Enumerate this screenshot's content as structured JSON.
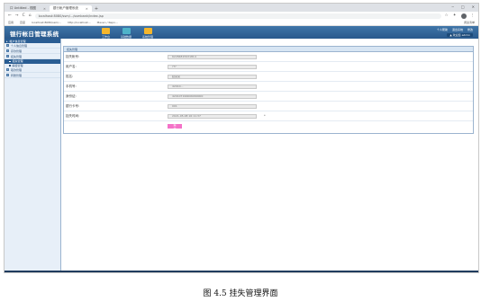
{
  "browser": {
    "tabs": [
      {
        "label": "口 Untitled - 视图",
        "active": false
      },
      {
        "label": "银行帐户管理系统",
        "active": true
      }
    ],
    "new_tab": "+",
    "window_controls": [
      "─",
      "□",
      "✕"
    ],
    "nav_buttons": [
      "←",
      "→",
      "C",
      "⌂"
    ],
    "url": "localhost:8080/ssm/.../ssmbank/index.jsp",
    "bookmarks": [
      "应用",
      "百度",
      "localhost:8080/ssm/...",
      "http://localhost...",
      "Maven / Repo..."
    ],
    "bookmarks_right": "阅读清单"
  },
  "app": {
    "title": "银行帐日管理系统",
    "modules": [
      {
        "label": "工作台",
        "icon": "workbench-icon"
      },
      {
        "label": "基础数据",
        "icon": "people-icon"
      },
      {
        "label": "系统管理",
        "icon": "folder-icon"
      }
    ],
    "header_links": [
      "个人帮助",
      "退出系统",
      "修改"
    ],
    "user_badge": "▲ 欢迎您 admin"
  },
  "sidebar": {
    "head": "帐户信息管理",
    "items": [
      {
        "label": "个人信息管理",
        "type": "item"
      },
      {
        "label": "存款管理",
        "type": "item"
      },
      {
        "label": "挂失管理",
        "type": "item"
      },
      {
        "label": "挂失管理",
        "type": "sub",
        "active": true
      },
      {
        "label": "解挂管理",
        "type": "sub",
        "active": false
      },
      {
        "label": "取款管理",
        "type": "item"
      },
      {
        "label": "转账管理",
        "type": "item"
      }
    ]
  },
  "form": {
    "panel_title": "挂失管理",
    "fields": [
      {
        "label": "挂失帐号:",
        "value": "62284815931814"
      },
      {
        "label": "用户名:",
        "value": "???"
      },
      {
        "label": "姓名:",
        "value": "赵某某"
      },
      {
        "label": "手机号:",
        "value": "42010..."
      },
      {
        "label": "身份证:",
        "value": "420107199606060000"
      },
      {
        "label": "银行卡号:",
        "value": "001"
      },
      {
        "label": "挂失时间:",
        "value": "2021-05-08 16:11:37"
      }
    ],
    "required_mark": "*",
    "submit_label": "提交"
  },
  "caption": "图 4.5 挂失管理界面",
  "colors": {
    "header_blue": "#28578a",
    "sidebar_active": "#2a5d93",
    "submit_pink": "#f472c8"
  }
}
